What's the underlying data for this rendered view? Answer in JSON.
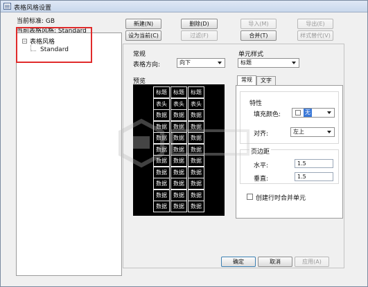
{
  "window": {
    "title": "表格风格设置"
  },
  "left": {
    "current_standard": "当前标准: GB",
    "current_style": "当前表格风格: Standard",
    "tree_root": "表格风格",
    "tree_child": "Standard"
  },
  "toolbar": {
    "new": "新建(N)",
    "delete": "删除(D)",
    "import": "导入(M)",
    "export": "导出(E)",
    "set_current": "设为当前(C)",
    "filter": "过滤(F)",
    "merge": "合并(T)",
    "style_replace": "样式替代(V)"
  },
  "general": {
    "heading": "常规",
    "direction_label": "表格方向:",
    "direction_value": "向下",
    "preview_label": "预览"
  },
  "preview": {
    "rows": [
      [
        "标题",
        "标题",
        "标题"
      ],
      [
        "表头",
        "表头",
        "表头"
      ],
      [
        "数据",
        "数据",
        "数据"
      ],
      [
        "数据",
        "数据",
        "数据"
      ],
      [
        "数据",
        "数据",
        "数据"
      ],
      [
        "数据",
        "数据",
        "数据"
      ],
      [
        "数据",
        "数据",
        "数据"
      ],
      [
        "数据",
        "数据",
        "数据"
      ],
      [
        "数据",
        "数据",
        "数据"
      ],
      [
        "数据",
        "数据",
        "数据"
      ],
      [
        "数据",
        "数据",
        "数据"
      ]
    ]
  },
  "cell_style": {
    "heading": "单元样式",
    "value": "标题",
    "tabs": [
      "常规",
      "文字"
    ],
    "properties_heading": "特性",
    "fill_color_label": "填充颜色:",
    "fill_color_value": "无",
    "align_label": "对齐:",
    "align_value": "左上",
    "margins_heading": "页边距",
    "horizontal_label": "水平:",
    "horizontal_value": "1.5",
    "vertical_label": "垂直:",
    "vertical_value": "1.5",
    "merge_checkbox_label": "创建行时合并单元",
    "merge_checked": false
  },
  "footer": {
    "ok": "确定",
    "cancel": "取消",
    "apply": "应用(A)"
  },
  "colors": {
    "highlight_box": "#e02a2a",
    "preview_bg": "#000000"
  }
}
